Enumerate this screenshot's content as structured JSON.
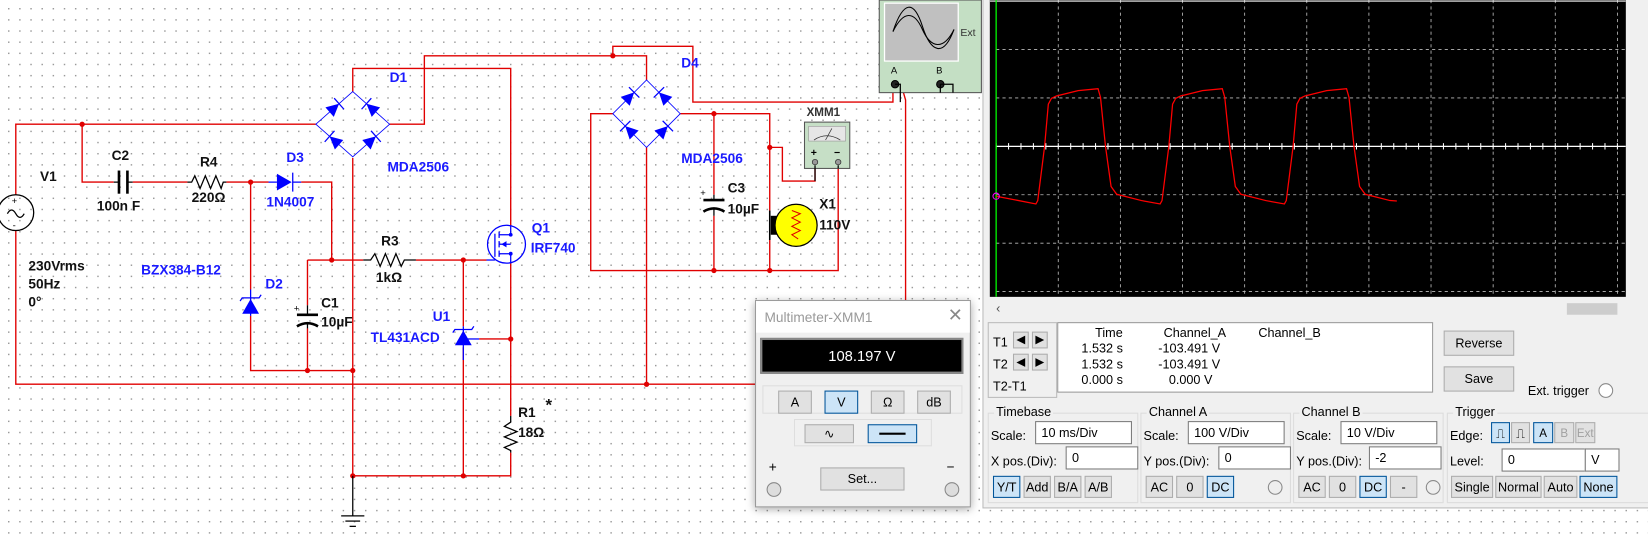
{
  "schematic": {
    "components": {
      "V1": {
        "ref": "V1",
        "value": "230Vrms",
        "freq": "50Hz",
        "phase": "0°"
      },
      "C2": {
        "ref": "C2",
        "value": "100n F"
      },
      "R4": {
        "ref": "R4",
        "value": "220Ω"
      },
      "D3": {
        "ref": "D3",
        "value": "1N4007"
      },
      "D1": {
        "ref": "D1",
        "value": "MDA2506"
      },
      "D2": {
        "ref": "D2",
        "value": "BZX384-B12"
      },
      "C1": {
        "ref": "C1",
        "value": "10µF"
      },
      "R3": {
        "ref": "R3",
        "value": "1kΩ"
      },
      "U1": {
        "ref": "U1",
        "value": "TL431ACD"
      },
      "Q1": {
        "ref": "Q1",
        "value": "IRF740"
      },
      "R1": {
        "ref": "R1",
        "value": "18Ω",
        "marker": "*"
      },
      "D4": {
        "ref": "D4",
        "value": "MDA2506"
      },
      "C3": {
        "ref": "C3",
        "value": "10µF"
      },
      "X1": {
        "ref": "X1",
        "value": "110V"
      },
      "XMM1": {
        "ref": "XMM1",
        "plus": "+",
        "minus": "−"
      },
      "XSC1": {
        "a": "A",
        "b": "B",
        "ext": "Ext"
      }
    },
    "colors": {
      "wire": "#e00000",
      "part": "#0000ff"
    }
  },
  "multimeter": {
    "title": "Multimeter-XMM1",
    "reading": "108.197 V",
    "modes": [
      {
        "label": "A",
        "active": false
      },
      {
        "label": "V",
        "active": true
      },
      {
        "label": "Ω",
        "active": false
      },
      {
        "label": "dB",
        "active": false
      }
    ],
    "coupling": [
      {
        "icon": "ac-wave-icon",
        "active": false
      },
      {
        "icon": "dc-line-icon",
        "active": true
      }
    ],
    "set_label": "Set...",
    "plus": "+",
    "minus": "−"
  },
  "oscilloscope": {
    "readout": {
      "headers": [
        "Time",
        "Channel_A",
        "Channel_B"
      ],
      "rows": [
        {
          "label": "T1",
          "time": "1.532 s",
          "a": "-103.491 V",
          "b": ""
        },
        {
          "label": "T2",
          "time": "1.532 s",
          "a": "-103.491 V",
          "b": ""
        },
        {
          "label": "T2-T1",
          "time": "0.000 s",
          "a": "0.000 V",
          "b": ""
        }
      ]
    },
    "reverse_label": "Reverse",
    "save_label": "Save",
    "ext_trigger_label": "Ext. trigger",
    "timebase": {
      "title": "Timebase",
      "scale_label": "Scale:",
      "scale": "10 ms/Div",
      "pos_label": "X pos.(Div):",
      "pos": "0",
      "buttons": [
        {
          "label": "Y/T",
          "active": true
        },
        {
          "label": "Add",
          "active": false
        },
        {
          "label": "B/A",
          "active": false
        },
        {
          "label": "A/B",
          "active": false
        }
      ]
    },
    "channel_a": {
      "title": "Channel A",
      "scale_label": "Scale:",
      "scale": "100  V/Div",
      "pos_label": "Y pos.(Div):",
      "pos": "0",
      "buttons": [
        {
          "label": "AC",
          "active": false
        },
        {
          "label": "0",
          "active": false
        },
        {
          "label": "DC",
          "active": true
        }
      ]
    },
    "channel_b": {
      "title": "Channel B",
      "scale_label": "Scale:",
      "scale": "10  V/Div",
      "pos_label": "Y pos.(Div):",
      "pos": "-2",
      "buttons": [
        {
          "label": "AC",
          "active": false
        },
        {
          "label": "0",
          "active": false
        },
        {
          "label": "DC",
          "active": true
        },
        {
          "label": "-",
          "active": false
        }
      ]
    },
    "trigger": {
      "title": "Trigger",
      "edge_label": "Edge:",
      "level_label": "Level:",
      "level": "0",
      "level_unit": "V",
      "sources": [
        {
          "label": "A",
          "active": true,
          "enabled": true
        },
        {
          "label": "B",
          "active": false,
          "enabled": false
        },
        {
          "label": "Ext",
          "active": false,
          "enabled": false
        }
      ],
      "modes": [
        {
          "label": "Single",
          "active": false
        },
        {
          "label": "Normal",
          "active": false
        },
        {
          "label": "Auto",
          "active": false
        },
        {
          "label": "None",
          "active": true
        }
      ]
    },
    "screen": {
      "background": "#000000",
      "trace_color": "#ff0000",
      "grid": true
    },
    "chart_data": {
      "type": "line",
      "xlabel": "",
      "ylabel": "",
      "x_unit": "ms",
      "y_unit": "V",
      "xlim": [
        0,
        100
      ],
      "ylim": [
        -300,
        300
      ],
      "series": [
        {
          "channel": "A",
          "points": [
            [
              0,
              -103
            ],
            [
              6.4,
              -119
            ],
            [
              6.7,
              -112
            ],
            [
              7.8,
              0
            ],
            [
              8.4,
              87
            ],
            [
              8.9,
              99
            ],
            [
              9.7,
              104
            ],
            [
              13.2,
              115
            ],
            [
              16.4,
              119
            ],
            [
              16.8,
              101
            ],
            [
              17.6,
              0
            ],
            [
              18.5,
              -83
            ],
            [
              19.4,
              -99
            ],
            [
              23.4,
              -112
            ],
            [
              26.4,
              -119
            ],
            [
              26.7,
              -112
            ],
            [
              27.8,
              0
            ],
            [
              28.4,
              87
            ],
            [
              28.9,
              99
            ],
            [
              29.7,
              104
            ],
            [
              33.2,
              115
            ],
            [
              36.4,
              119
            ],
            [
              36.8,
              101
            ],
            [
              37.6,
              0
            ],
            [
              38.5,
              -83
            ],
            [
              39.4,
              -99
            ],
            [
              43.4,
              -112
            ],
            [
              46.4,
              -119
            ],
            [
              46.7,
              -112
            ],
            [
              47.8,
              0
            ],
            [
              48.4,
              87
            ],
            [
              48.9,
              99
            ],
            [
              49.7,
              104
            ],
            [
              53.2,
              115
            ],
            [
              56.4,
              119
            ],
            [
              56.8,
              101
            ],
            [
              57.6,
              0
            ],
            [
              58.5,
              -83
            ],
            [
              59.4,
              -99
            ],
            [
              63.4,
              -112
            ],
            [
              64.5,
              -113
            ]
          ]
        }
      ]
    }
  }
}
